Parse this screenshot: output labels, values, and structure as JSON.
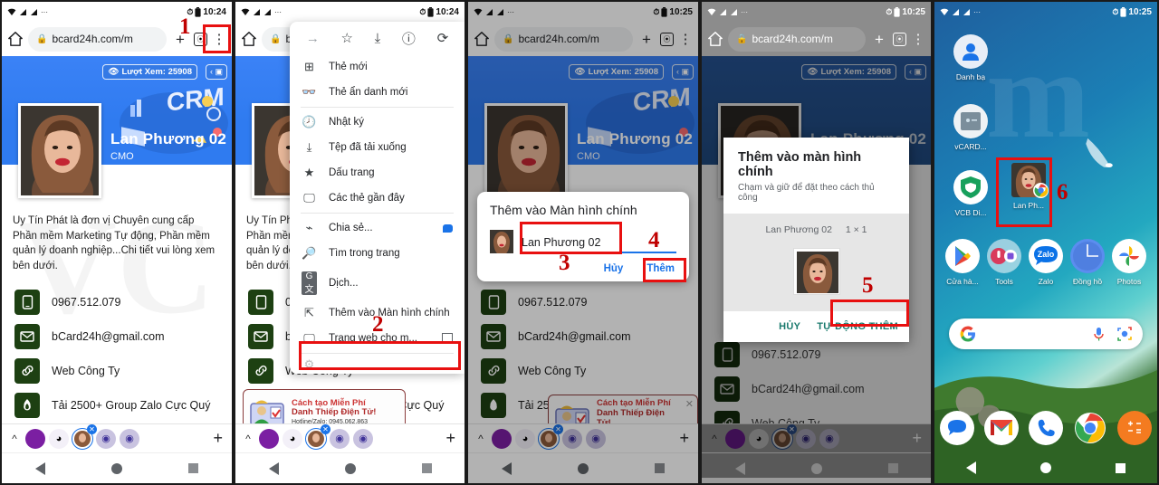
{
  "status_bar": {
    "time_1": "10:24",
    "time_2": "10:25",
    "alarm_icon": "alarm-icon",
    "battery_icon": "battery-icon",
    "wifi_icon": "wifi-icon",
    "signal_icon": "signal-icon"
  },
  "browser": {
    "url": "bcard24h.com/m",
    "home_icon": "home-icon",
    "lock_icon": "lock-icon",
    "new_tab_icon": "plus-icon",
    "tab_switcher_icon": "tab-switcher-icon",
    "menu_icon": "kebab-menu-icon"
  },
  "card": {
    "views_badge": "Lượt Xem: 25908",
    "eye_icon": "eye-icon",
    "name": "Lan Phương 02",
    "role": "CMO",
    "bio": "Uy Tín Phát là đơn vị Chuyên cung cấp Phần mềm Marketing Tự động, Phần mềm quản lý doanh nghiệp...Chi tiết vui lòng xem bên dưới.",
    "contacts": [
      {
        "icon": "phone-icon",
        "glyph": "✆",
        "text": "0967.512.079"
      },
      {
        "icon": "email-icon",
        "glyph": "✉",
        "text": "bCard24h@gmail.com"
      },
      {
        "icon": "link-icon",
        "glyph": "⚭",
        "text": "Web Công Ty"
      },
      {
        "icon": "flame-icon",
        "glyph": "⚡",
        "text": "Tải 2500+ Group Zalo Cực Quý"
      }
    ],
    "ad": {
      "line1": "Cách tạo Miễn Phí",
      "line2": "Danh Thiếp Điện Tử!",
      "line3": "Hotline/Zalo: 0945.062.863",
      "close_icon": "close-icon"
    }
  },
  "chrome_menu": {
    "top_icons": [
      {
        "name": "forward-icon",
        "glyph": "→"
      },
      {
        "name": "bookmark-star-icon",
        "glyph": "☆"
      },
      {
        "name": "download-icon",
        "glyph": "⬇"
      },
      {
        "name": "page-info-icon",
        "glyph": "ⓘ"
      },
      {
        "name": "reload-icon",
        "glyph": "⟳"
      }
    ],
    "items": [
      {
        "label": "Thẻ mới",
        "icon": "new-tab-icon",
        "glyph": "⊞"
      },
      {
        "label": "Thẻ ẩn danh mới",
        "icon": "incognito-icon",
        "glyph": "◑"
      },
      {
        "label": "Nhật ký",
        "icon": "history-icon",
        "glyph": "↺"
      },
      {
        "label": "Tệp đã tải xuống",
        "icon": "downloads-icon",
        "glyph": "⤓"
      },
      {
        "label": "Dấu trang",
        "icon": "bookmarks-star-icon",
        "glyph": "★"
      },
      {
        "label": "Các thẻ gần đây",
        "icon": "recent-tabs-icon",
        "glyph": "❐"
      },
      {
        "label": "Chia sẻ...",
        "icon": "share-icon",
        "glyph": "⤳",
        "trailing": "blue-dot"
      },
      {
        "label": "Tìm trong trang",
        "icon": "find-in-page-icon",
        "glyph": "⌕"
      },
      {
        "label": "Dịch...",
        "icon": "translate-icon",
        "glyph": "文"
      },
      {
        "label": "Thêm vào Màn hình chính",
        "icon": "add-to-home-icon",
        "glyph": "↗",
        "highlighted": true
      },
      {
        "label": "Trang web cho m...",
        "icon": "desktop-site-icon",
        "glyph": "☐",
        "trailing": "checkbox"
      }
    ]
  },
  "add_dialog": {
    "title": "Thêm vào Màn hình chính",
    "shortcut_name": "Lan Phương 02",
    "cancel": "Hủy",
    "confirm": "Thêm"
  },
  "widget_dialog": {
    "title": "Thêm vào màn hình chính",
    "subtitle": "Chạm và giữ để đặt theo cách thủ công",
    "widget_label": "Lan Phương 02",
    "widget_size": "1 × 1",
    "cancel": "HỦY",
    "confirm": "TỰ ĐỘNG THÊM"
  },
  "home_screen": {
    "left_column": [
      {
        "label": "Danh bạ",
        "icon": "contacts-icon"
      },
      {
        "label": "vCARD...",
        "icon": "vcard-icon"
      },
      {
        "label": "VCB Di...",
        "icon": "vcb-digibank-icon"
      }
    ],
    "shortcut": {
      "label": "Lan Ph...",
      "icon": "chrome-shortcut-icon"
    },
    "app_row": [
      {
        "label": "Cửa hà...",
        "icon": "play-store-icon"
      },
      {
        "label": "Tools",
        "icon": "tools-folder-icon"
      },
      {
        "label": "Zalo",
        "icon": "zalo-icon"
      },
      {
        "label": "Đồng hồ",
        "icon": "clock-icon"
      },
      {
        "label": "Photos",
        "icon": "google-photos-icon"
      }
    ],
    "search": {
      "google_icon": "google-g-icon",
      "mic_icon": "microphone-icon",
      "lens_icon": "google-lens-icon"
    },
    "dock": [
      {
        "icon": "messages-icon"
      },
      {
        "icon": "gmail-icon"
      },
      {
        "icon": "phone-icon"
      },
      {
        "icon": "chrome-icon"
      },
      {
        "icon": "calculator-icon"
      }
    ]
  },
  "annotations": {
    "steps": [
      "1",
      "2",
      "3",
      "4",
      "5",
      "6"
    ],
    "color": "#c00000",
    "box_color": "#e81010"
  },
  "nav_bar": {
    "back": "back-button",
    "home": "home-button",
    "recents": "recents-button"
  }
}
